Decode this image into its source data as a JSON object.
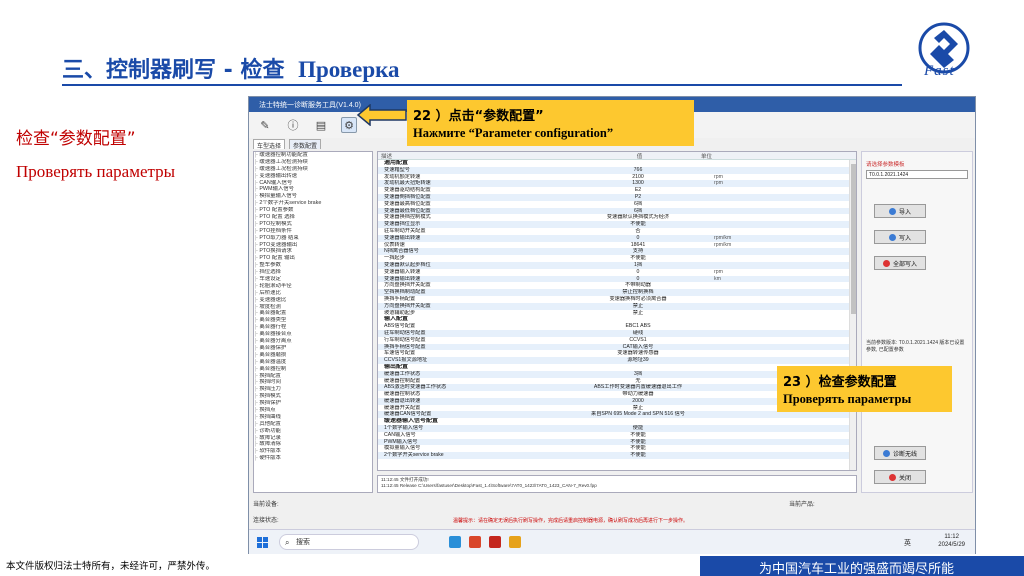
{
  "slide": {
    "title_cn": "三、控制器刷写 - 检查",
    "title_ru": "Проверка",
    "logo_text": "Fast",
    "left_cn": "检查“参数配置”",
    "left_ru": "Проверять параметры",
    "copyright": "本文件版权归法士特所有，未经许可，严禁外传。",
    "slogan": "为中国汽车工业的强盛而竭尽所能"
  },
  "callouts": {
    "c22_cn": "22 ）点击“参数配置”",
    "c22_ru": "Нажмите “Parameter configuration”",
    "c23_cn": "23 ）检查参数配置",
    "c23_ru": "Проверять параметры"
  },
  "colors": {
    "title": "#1a4aa8",
    "red": "#c00000",
    "callout": "#fdc82f"
  },
  "app": {
    "title": "法士特统一诊断服务工具(V1.4.0)",
    "tabs": [
      "车型选择",
      "参数配置"
    ],
    "toolbar_icons": [
      "pen-icon",
      "info-icon",
      "document-icon",
      "gear-icon"
    ],
    "grid_headers": [
      "描述",
      "值",
      "单位"
    ],
    "rows": [
      {
        "type": "group",
        "name": "通用配置",
        "value": "",
        "unit": ""
      },
      {
        "type": "row",
        "name": "变速箱型号",
        "value": "766",
        "unit": ""
      },
      {
        "type": "row",
        "name": "发动机额定转速",
        "value": "2100",
        "unit": "rpm"
      },
      {
        "type": "row",
        "name": "发动机最大扭矩转速",
        "value": "1300",
        "unit": "rpm"
      },
      {
        "type": "row",
        "name": "变速器驱动结构配置",
        "value": "E2",
        "unit": ""
      },
      {
        "type": "row",
        "name": "变速器倒挡档位配置",
        "value": "P2",
        "unit": ""
      },
      {
        "type": "row",
        "name": "变速器最高档位配置",
        "value": "6挡",
        "unit": ""
      },
      {
        "type": "row",
        "name": "变速器最低档位配置",
        "value": "6挡",
        "unit": ""
      },
      {
        "type": "row",
        "name": "变速器换档控制模式",
        "value": "变速器默认换挡模式为经济",
        "unit": ""
      },
      {
        "type": "row",
        "name": "变速器挡位显示",
        "value": "不使能",
        "unit": ""
      },
      {
        "type": "row",
        "name": "驻车制动开关配置",
        "value": "否",
        "unit": ""
      },
      {
        "type": "row",
        "name": "变速器输出转速",
        "value": "0",
        "unit": "rpm/km"
      },
      {
        "type": "row",
        "name": "仪表转速",
        "value": "18641",
        "unit": "rpm/km"
      },
      {
        "type": "row",
        "name": "N挡离合器信号",
        "value": "支持",
        "unit": ""
      },
      {
        "type": "row",
        "name": "一挡起步",
        "value": "不使能",
        "unit": ""
      },
      {
        "type": "row",
        "name": "变速器默认起步档位",
        "value": "1挡",
        "unit": ""
      },
      {
        "type": "row",
        "name": "变速器输入转速",
        "value": "0",
        "unit": "rpm"
      },
      {
        "type": "row",
        "name": "变速器输出转速",
        "value": "0",
        "unit": "km"
      },
      {
        "type": "row",
        "name": "方向盘换挡开关配置",
        "value": "不带制动器",
        "unit": ""
      },
      {
        "type": "row",
        "name": "空挡换档制动配置",
        "value": "禁止控制换档",
        "unit": ""
      },
      {
        "type": "row",
        "name": "换挡手柄配置",
        "value": "变速器换档时必须离合器",
        "unit": ""
      },
      {
        "type": "row",
        "name": "方向盘换挡开关配置",
        "value": "禁止",
        "unit": ""
      },
      {
        "type": "row",
        "name": "坡道辅助起步",
        "value": "禁止",
        "unit": ""
      },
      {
        "type": "group",
        "name": "输入配置",
        "value": "",
        "unit": ""
      },
      {
        "type": "row",
        "name": "ABS信号配置",
        "value": "EBC1 ABS",
        "unit": ""
      },
      {
        "type": "row",
        "name": "驻车制动信号配置",
        "value": "硬线",
        "unit": ""
      },
      {
        "type": "row",
        "name": "行车制动信号配置",
        "value": "CCVS1",
        "unit": ""
      },
      {
        "type": "row",
        "name": "换挡手柄信号配置",
        "value": "CAT输入信号",
        "unit": ""
      },
      {
        "type": "row",
        "name": "车速信号配置",
        "value": "变速器转速传感器",
        "unit": ""
      },
      {
        "type": "row",
        "name": "CCVS1报文源地址",
        "value": "源地址39",
        "unit": ""
      },
      {
        "type": "group",
        "name": "输出配置",
        "value": "",
        "unit": ""
      },
      {
        "type": "row",
        "name": "缓速器工作状态",
        "value": "3挡",
        "unit": ""
      },
      {
        "type": "row",
        "name": "缓速器控制配置",
        "value": "无",
        "unit": ""
      },
      {
        "type": "row",
        "name": "ABS激活时变速器工作状态",
        "value": "ABS工作时变速器内置缓速器退出工作",
        "unit": ""
      },
      {
        "type": "row",
        "name": "缓速器控制状态",
        "value": "带动力缓速器",
        "unit": ""
      },
      {
        "type": "row",
        "name": "缓速器退出转速",
        "value": "2000",
        "unit": ""
      },
      {
        "type": "row",
        "name": "缓速器开关配置",
        "value": "禁止",
        "unit": ""
      },
      {
        "type": "row",
        "name": "缓速器CAN信号配置",
        "value": "来自SPN 695 Mode 2 and SPN 516 信号",
        "unit": ""
      },
      {
        "type": "group",
        "name": "缓速器输入信号配置",
        "value": "",
        "unit": ""
      },
      {
        "type": "row",
        "name": "1个数字输入信号",
        "value": "使能",
        "unit": ""
      },
      {
        "type": "row",
        "name": "CAN输入信号",
        "value": "不使能",
        "unit": ""
      },
      {
        "type": "row",
        "name": "PWM输入信号",
        "value": "不使能",
        "unit": ""
      },
      {
        "type": "row",
        "name": "模拟量输入信号",
        "value": "不使能",
        "unit": ""
      },
      {
        "type": "row",
        "name": "2个数字开关service brake",
        "value": "不使能",
        "unit": ""
      }
    ],
    "tree_items": [
      "缓速器控制功能配置",
      "缓速器工况检测持续",
      "缓速器工况检测持续",
      "变速器输出转速",
      "CAN输入信号",
      "PWM输入信号",
      "模拟量输入信号",
      "2个数字开关service brake",
      "PTO 配置参数",
      "PTO 配置 选择",
      "PTO控制模式",
      "PTO挂档条件",
      "PTO取力器 结束",
      "PTO变速器输出",
      "PTO换挡请求",
      "PTO 配置 输出",
      "整车参数",
      "挡位选择",
      "车速设定",
      "轮胎滚动半径",
      "后桥速比",
      "变速器速比",
      "坡度检测",
      "离合器配置",
      "离合器类型",
      "离合器行程",
      "离合器接合点",
      "离合器分离点",
      "离合器保护",
      "离合器磨损",
      "离合器温度",
      "离合器控制",
      "换挡配置",
      "换挡时间",
      "换挡压力",
      "换挡模式",
      "换挡保护",
      "换挡点",
      "换挡曲线",
      "其他配置",
      "诊断功能",
      "故障记录",
      "故障清除",
      "软件版本",
      "硬件版本"
    ],
    "log_lines": [
      "11:12:45 文件打开成功!",
      "11:12:45 Release C:\\Users\\fastuser\\Desktop\\Fast_1.4\\Software\\7AT0_1423\\7AT0_1423_CAN-7_Rev0.fpp"
    ],
    "right": {
      "label": "请选择参数模板",
      "select": "T0.0.1.2021.1424",
      "btn_import": "导入",
      "btn_write": "写入",
      "btn_export": "全部写入",
      "btn_diag": "诊断无线",
      "btn_close": "关闭",
      "note": "当前参数版本: T0.0.1.2021.1424 版本已设置 参数, 已配置参数"
    },
    "status_left": "当前设备:",
    "status_right": "当前产品:",
    "status2_left": "连接状态:",
    "marquee": "温馨提示：请在确定无误后执行刷写操作，完成后请重启控制器电源，确认刷写成功后再进行下一步操作。",
    "taskbar_search": "搜索",
    "tray_lang": "英",
    "clock_time": "11:12",
    "clock_date": "2024/5/29"
  }
}
